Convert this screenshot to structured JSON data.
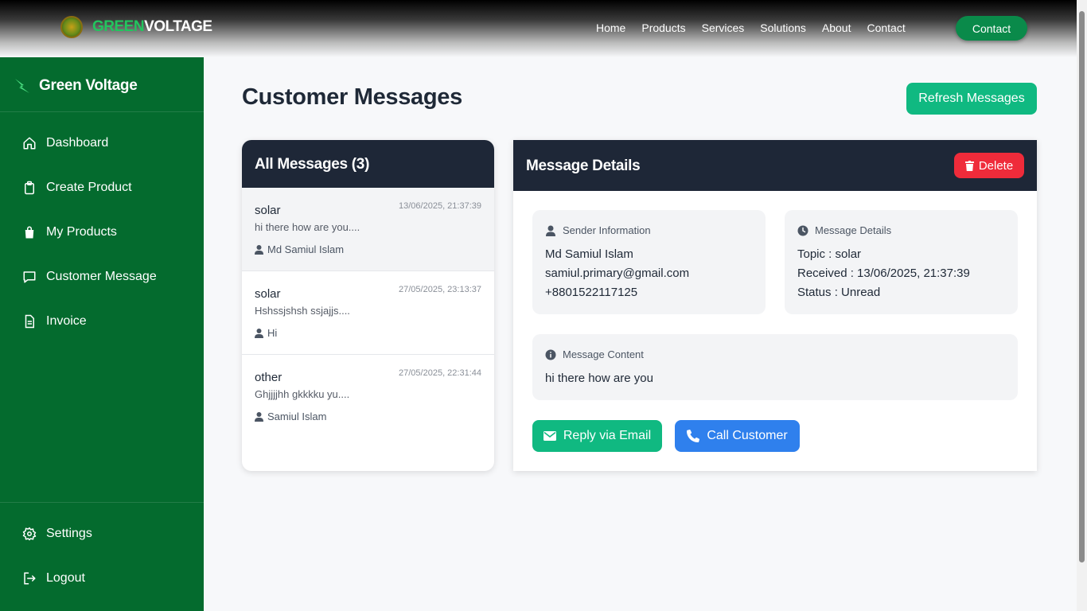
{
  "topnav": {
    "brand_green": "GREEN",
    "brand_white": "VOLTAGE",
    "links": [
      "Home",
      "Products",
      "Services",
      "Solutions",
      "About",
      "Contact"
    ],
    "contact_button": "Contact"
  },
  "sidebar": {
    "brand": "Green Voltage",
    "items": [
      {
        "label": "Dashboard",
        "icon": "home-icon"
      },
      {
        "label": "Create Product",
        "icon": "clipboard-icon"
      },
      {
        "label": "My Products",
        "icon": "shopping-bag-icon"
      },
      {
        "label": "Customer Message",
        "icon": "chat-icon"
      },
      {
        "label": "Invoice",
        "icon": "document-icon"
      }
    ],
    "bottom": [
      {
        "label": "Settings",
        "icon": "gear-icon"
      },
      {
        "label": "Logout",
        "icon": "logout-icon"
      }
    ]
  },
  "main": {
    "title": "Customer Messages",
    "refresh_button": "Refresh Messages"
  },
  "messages": {
    "header": "All Messages (3)",
    "items": [
      {
        "topic": "solar",
        "date": "13/06/2025, 21:37:39",
        "preview": "hi there how are you....",
        "sender": "Md Samiul Islam"
      },
      {
        "topic": "solar",
        "date": "27/05/2025, 23:13:37",
        "preview": "Hshssjshsh ssjajjs....",
        "sender": "Hi"
      },
      {
        "topic": "other",
        "date": "27/05/2025, 22:31:44",
        "preview": "Ghjjjjhh gkkkku yu....",
        "sender": "Samiul Islam"
      }
    ]
  },
  "details": {
    "header": "Message Details",
    "delete_button": "Delete",
    "sender_title": "Sender Information",
    "sender_name": "Md Samiul Islam",
    "sender_email": "samiul.primary@gmail.com",
    "sender_phone": "+8801522117125",
    "meta_title": "Message Details",
    "topic_line": "Topic : solar",
    "received_line": "Received : 13/06/2025, 21:37:39",
    "status_line": "Status : Unread",
    "content_title": "Message Content",
    "content": "hi there how are you",
    "reply_button": "Reply via Email",
    "call_button": "Call Customer"
  },
  "colors": {
    "sidebar": "#046b2e",
    "accent_green": "#10b981",
    "danger": "#ef2b3a",
    "blue": "#2f80ed",
    "panel_header": "#1e2737"
  }
}
